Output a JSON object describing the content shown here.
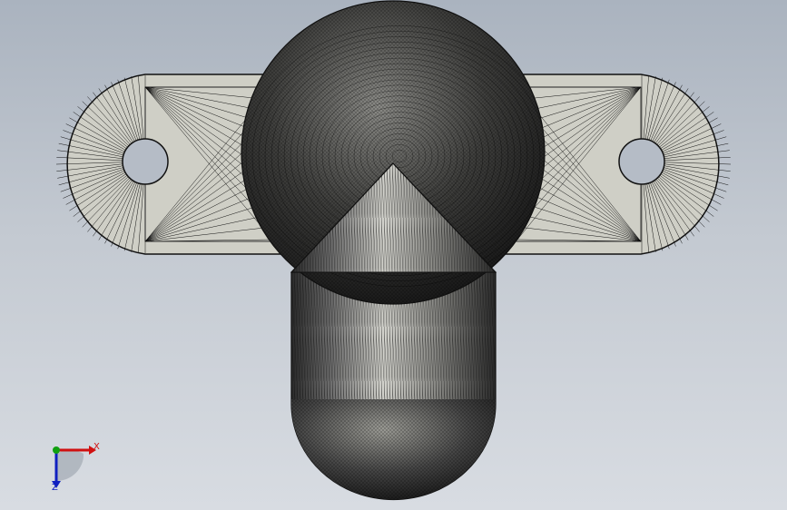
{
  "viewport": {
    "background_top": "#aab3bf",
    "background_bottom": "#d8dce2"
  },
  "model": {
    "face_color": "#cfcfc6",
    "edge_color": "#111111",
    "display_mode": "wireframe-mesh-shaded",
    "parts": [
      "mounting-flange",
      "spherical-head",
      "capsule-body",
      "mounting-hole-left",
      "mounting-hole-right"
    ]
  },
  "triad": {
    "x_label": "X",
    "y_label": "Z",
    "x_color": "#d01010",
    "y_color": "#1020c0",
    "origin_color": "#10a010"
  }
}
